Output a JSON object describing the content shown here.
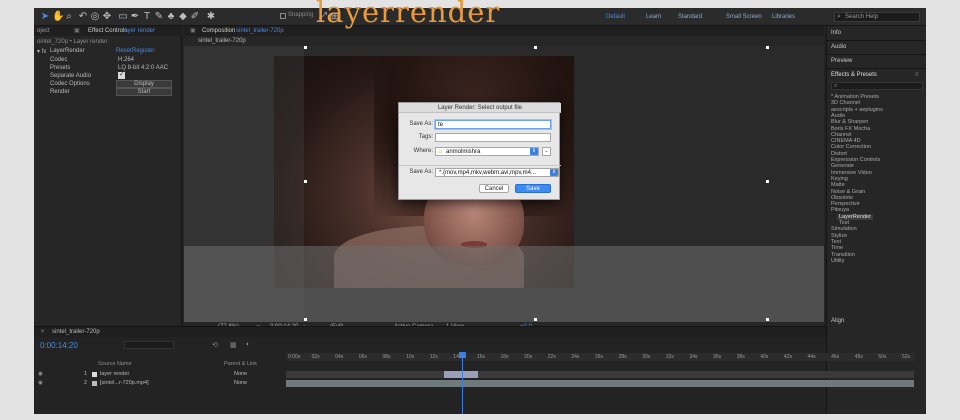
{
  "toolbar": {
    "snapping_label": "Snapping",
    "workspaces": [
      "Default",
      "Learn",
      "Standard",
      "Small Screen",
      "Libraries"
    ],
    "search_placeholder": "Search Help"
  },
  "watermark": "layerrender",
  "left_panel": {
    "tab_left": "oject",
    "tab_effect_controls": "Effect Controls",
    "tab_effect_target": "layer render",
    "breadcrumb": "ointel_720p • Layer render",
    "effect_name": "LayerRender",
    "reset": "Reset",
    "register": "Register",
    "rows": [
      {
        "label": "Codec",
        "value": "H.264"
      },
      {
        "label": "Presets",
        "value": "LQ 8-bit 4:2:0 AAC"
      },
      {
        "label": "Separate Audio",
        "value": "✓"
      },
      {
        "label": "Codec Options",
        "value": "Display"
      },
      {
        "label": "Render",
        "value": "Start"
      }
    ]
  },
  "composition": {
    "tab_label": "Composition",
    "tab_target": "sintel_trailer-720p",
    "subtab": "sintel_trailer-720p",
    "controls": {
      "zoom": "(77.8%)",
      "timecode": "0:00:14:20",
      "resolution": "(Full)",
      "camera": "Active Camera",
      "views": "1 View",
      "exposure": "+0.0"
    }
  },
  "dialog": {
    "title": "Layer Render: Select output file",
    "save_as_label": "Save As:",
    "save_as_value": "te",
    "tags_label": "Tags:",
    "tags_value": "",
    "where_label": "Where:",
    "where_value": "anmolmishra",
    "format_label": "Save As:",
    "format_value": "*.{mov,mp4,mkv,webm,avi,mpv,m4...",
    "cancel": "Cancel",
    "save": "Save"
  },
  "right_panel": {
    "info": "Info",
    "audio": "Audio",
    "preview": "Preview",
    "effects_presets": "Effects & Presets",
    "tree": [
      "* Animation Presets",
      "3D Channel",
      "aescripts + aeplugins",
      "Audio",
      "Blur & Sharpen",
      "Boris FX Mocha",
      "Channel",
      "CINEMA 4D",
      "Color Correction",
      "Distort",
      "Expression Controls",
      "Generate",
      "Immersive Video",
      "Keying",
      "Matte",
      "Noise & Grain",
      "Obsolete",
      "Perspective",
      "Pitsuya"
    ],
    "tree_children": [
      "LayerRender",
      "Test"
    ],
    "tree_after": [
      "Simulation",
      "Stylize",
      "Text",
      "Time",
      "Transition",
      "Utility"
    ],
    "align": "Align"
  },
  "timeline": {
    "comp_tab": "sintel_trailer-720p",
    "current_time": "0:00:14:20",
    "col_source": "Source Name",
    "col_parent": "Parent & Link",
    "layers": [
      {
        "num": "1",
        "name": "layer render",
        "parent": "None"
      },
      {
        "num": "2",
        "name": "[sintel...r-720p.mp4]",
        "parent": "None"
      }
    ],
    "ruler_ticks": [
      "0:00s",
      "02s",
      "04s",
      "06s",
      "08s",
      "10s",
      "12s",
      "14s",
      "16s",
      "18s",
      "20s",
      "22s",
      "24s",
      "26s",
      "28s",
      "30s",
      "32s",
      "34s",
      "36s",
      "38s",
      "40s",
      "42s",
      "44s",
      "46s",
      "48s",
      "50s",
      "52s"
    ]
  }
}
